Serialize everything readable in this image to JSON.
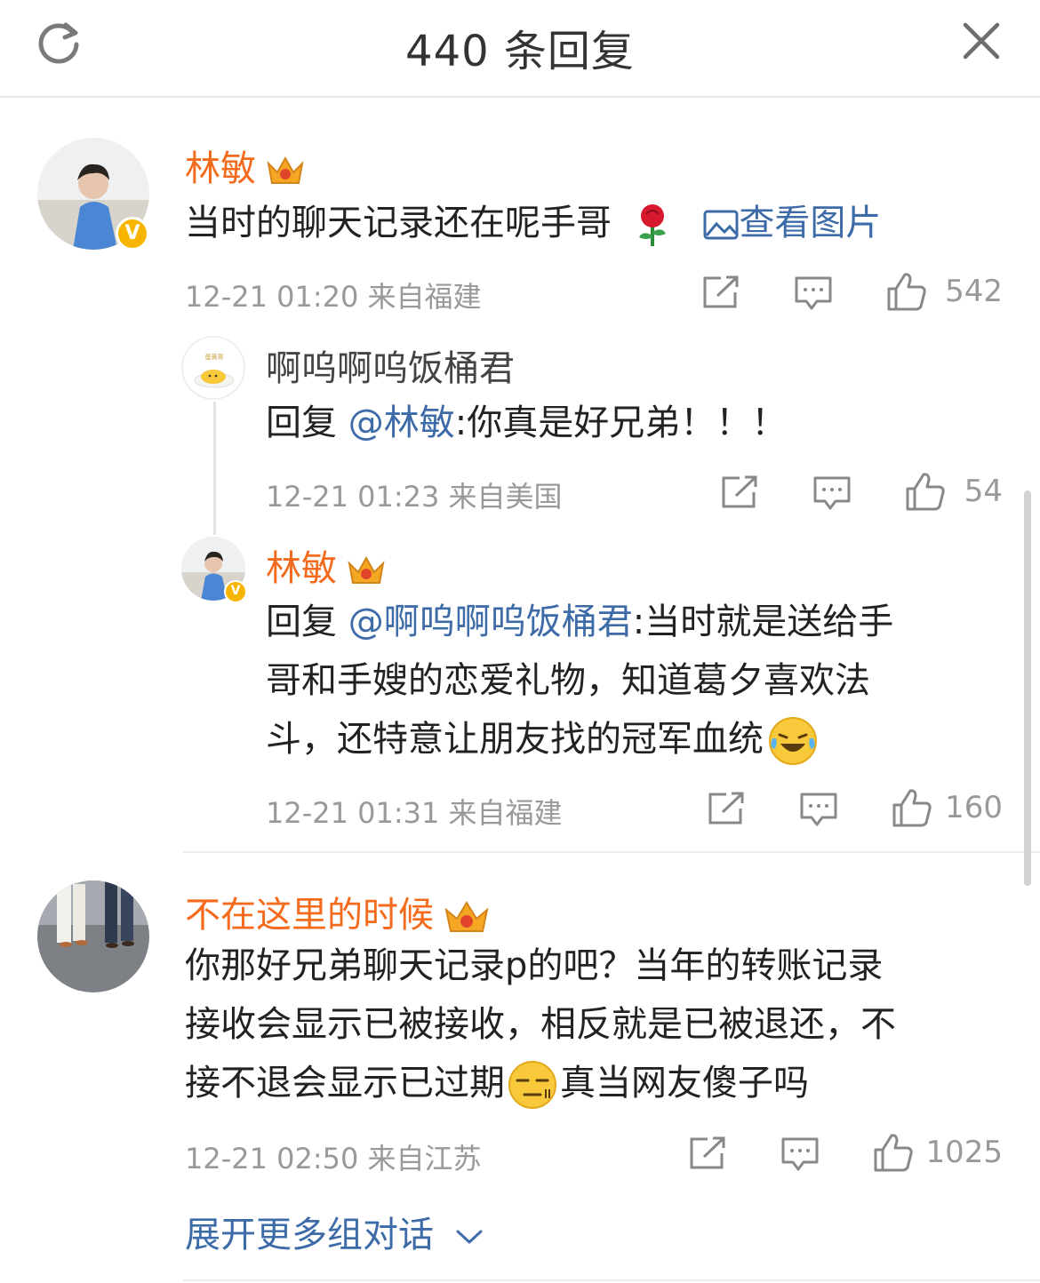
{
  "header": {
    "title": "440 条回复"
  },
  "comments": [
    {
      "user": "林敏",
      "text": "当时的聊天记录还在呢手哥",
      "link": "查看图片",
      "meta": "12-21 01:20  来自福建",
      "likes": "542",
      "replies": [
        {
          "user": "啊呜啊呜饭桶君",
          "reply_prefix": "回复",
          "mention": "@林敏",
          "text": ":你真是好兄弟！！！",
          "meta": "12-21 01:23  来自美国",
          "likes": "54"
        },
        {
          "user": "林敏",
          "reply_prefix": "回复",
          "mention": "@啊呜啊呜饭桶君",
          "text_line1": ":当时就是送给手",
          "text_line2": "哥和手嫂的恋爱礼物，知道葛夕喜欢法",
          "text_line3": "斗，还特意让朋友找的冠军血统",
          "meta": "12-21 01:31  来自福建",
          "likes": "160"
        }
      ]
    },
    {
      "user": "不在这里的时候",
      "text_line1": "你那好兄弟聊天记录p的吧？当年的转账记录",
      "text_line2": "接收会显示已被接收，相反就是已被退还，不",
      "text_line3": "接不退会显示已过期",
      "text_line3_end": "真当网友傻子吗",
      "meta": "12-21 02:50  来自江苏",
      "likes": "1025"
    }
  ],
  "footer": {
    "expand_label": "展开更多组对话"
  },
  "icons": {
    "refresh": "refresh-icon",
    "close": "close-icon",
    "crown": "crown-icon",
    "rose": "rose-emoji",
    "laugh": "laugh-cry-emoji",
    "smirk": "smirk-emoji",
    "share": "share-icon",
    "comment": "comment-icon",
    "like": "like-icon",
    "image": "image-icon",
    "chevron": "chevron-down-icon"
  },
  "colors": {
    "username": "#f46b1d",
    "link": "#3d6ba8",
    "meta": "#999999",
    "verified": "#f7b500"
  }
}
